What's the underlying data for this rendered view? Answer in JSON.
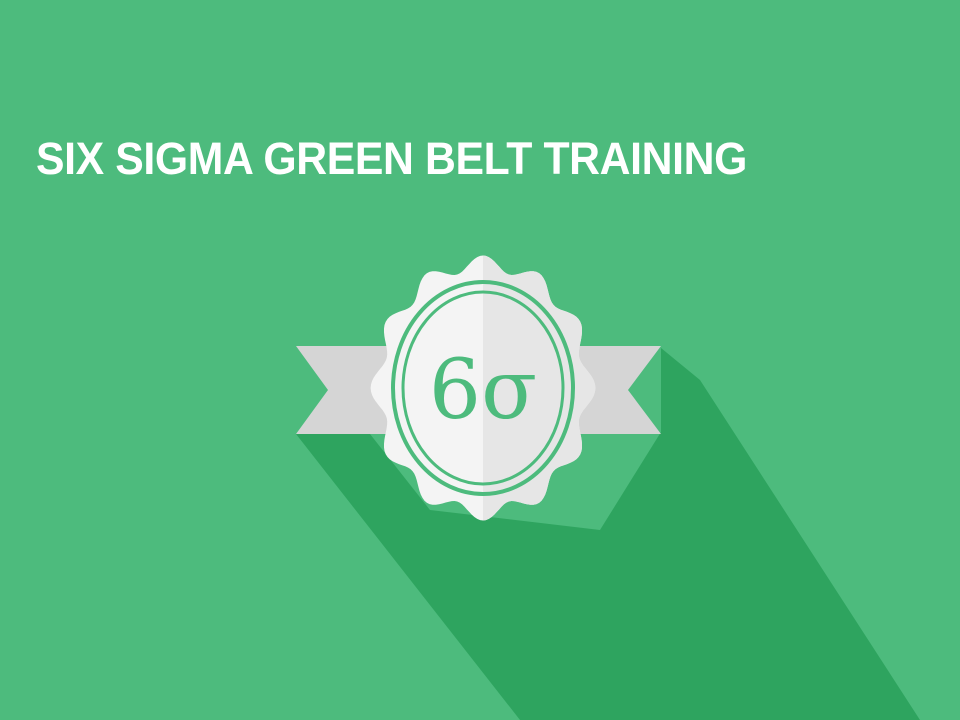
{
  "title": "SIX SIGMA GREEN BELT TRAINING",
  "badge": {
    "symbol": "6σ",
    "icon": "rosette-badge-icon"
  },
  "colors": {
    "background": "#4dbb7d",
    "long_shadow": "#2ea45f",
    "badge_face": "#f4f4f4",
    "ribbon": "#d5d5d5",
    "accent_green": "#4dbb7d"
  }
}
